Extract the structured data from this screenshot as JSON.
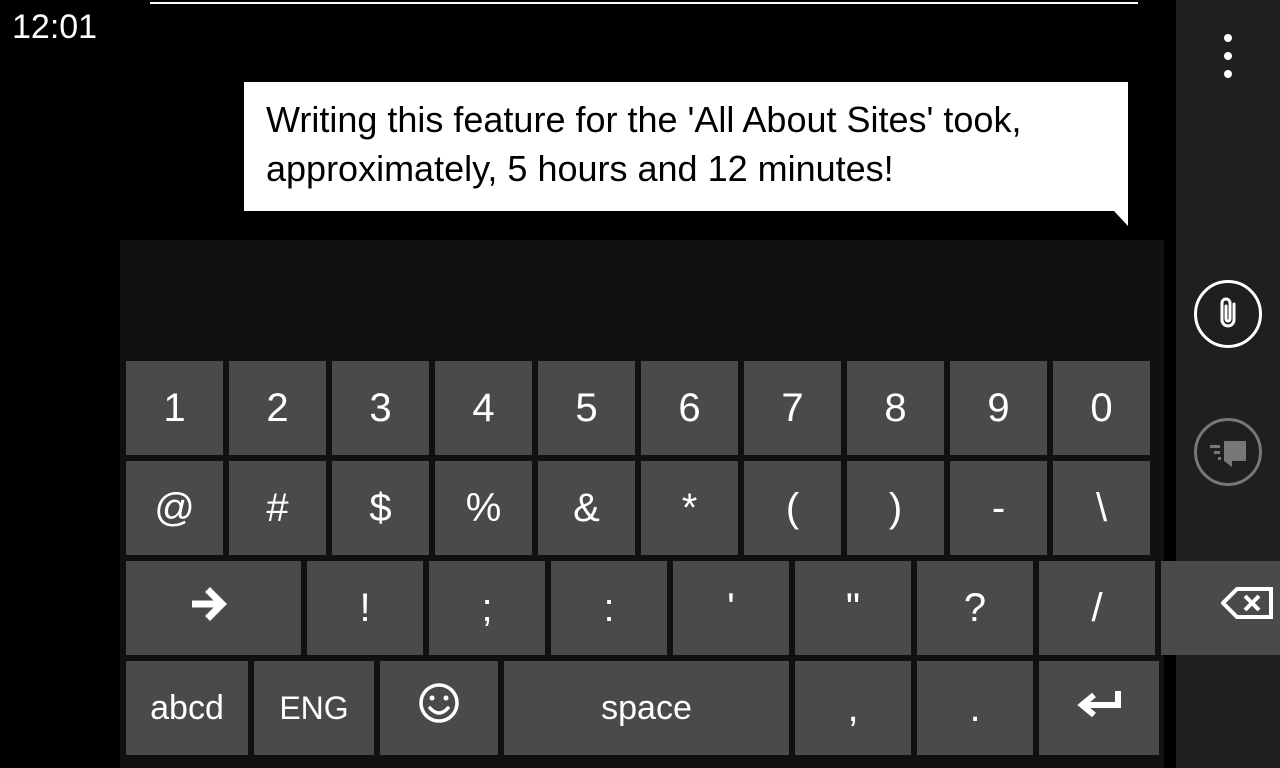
{
  "status": {
    "time": "12:01"
  },
  "message": {
    "text": "Writing this feature for the 'All About Sites' took, approximately, 5 hours and 12 minutes!"
  },
  "keyboard": {
    "row1": [
      "1",
      "2",
      "3",
      "4",
      "5",
      "6",
      "7",
      "8",
      "9",
      "0"
    ],
    "row2": [
      "@",
      "#",
      "$",
      "%",
      "&",
      "*",
      "(",
      ")",
      "-",
      "\\"
    ],
    "row3": {
      "shift": "→",
      "keys": [
        "!",
        ";",
        ":",
        "'",
        "\"",
        "?",
        "/"
      ],
      "backspace": "⌫"
    },
    "row4": {
      "mode": "abcd",
      "lang": "ENG",
      "space": "space",
      "comma": ",",
      "period": "."
    }
  }
}
